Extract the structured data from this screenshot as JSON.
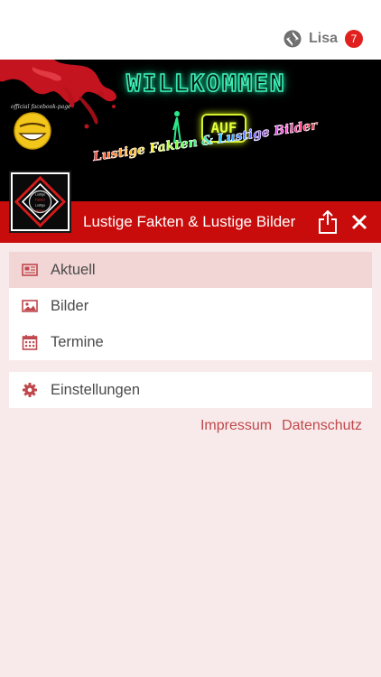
{
  "header": {
    "user_name": "Lisa",
    "notification_count": "7",
    "user_icon": "app-logo-icon"
  },
  "banner": {
    "fb_label": "official facebook-page",
    "welcome_text": "WILLKOMMEN",
    "auf_text": "AUF",
    "subtitle_text": "Lustige Fakten & Lustige Bilder",
    "logo_lines": [
      "Lustige",
      "Fakten",
      "Lustige",
      "Bilder"
    ]
  },
  "titlebar": {
    "title": "Lustige Fakten & Lustige Bilder",
    "share_icon": "share-icon",
    "close_icon": "close-icon"
  },
  "menu": {
    "items": [
      {
        "label": "Aktuell",
        "icon": "newspaper-icon",
        "active": true
      },
      {
        "label": "Bilder",
        "icon": "image-icon",
        "active": false
      },
      {
        "label": "Termine",
        "icon": "calendar-icon",
        "active": false
      }
    ],
    "settings": {
      "label": "Einstellungen",
      "icon": "gear-icon"
    }
  },
  "footer": {
    "impressum": "Impressum",
    "datenschutz": "Datenschutz"
  },
  "colors": {
    "accent_red": "#c80c0c",
    "link_red": "#c0484c",
    "badge_red": "#e0201f",
    "background": "#f8eaea",
    "active_item": "#f2d6d6"
  }
}
